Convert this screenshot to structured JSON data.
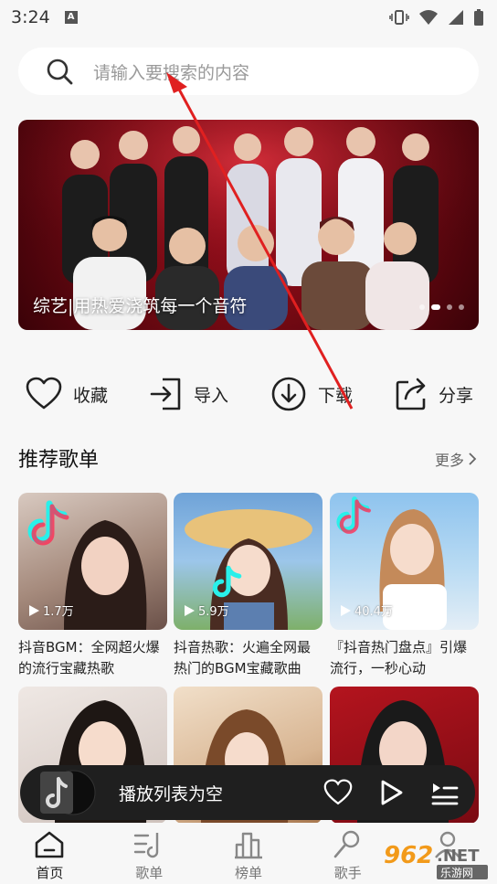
{
  "status": {
    "time": "3:24",
    "a_badge": "A"
  },
  "search": {
    "placeholder": "请输入要搜索的内容"
  },
  "banner": {
    "caption": "综艺|用热爱浇筑每一个音符",
    "dots": 4,
    "active_dot": 1
  },
  "actions": [
    {
      "label": "收藏",
      "icon": "heart-icon"
    },
    {
      "label": "导入",
      "icon": "import-icon"
    },
    {
      "label": "下载",
      "icon": "download-icon"
    },
    {
      "label": "分享",
      "icon": "share-icon"
    }
  ],
  "section": {
    "title": "推荐歌单",
    "more": "更多"
  },
  "playlists": [
    {
      "count": "1.7万",
      "title": "抖音BGM：全网超火爆的流行宝藏热歌"
    },
    {
      "count": "5.9万",
      "title": "抖音热歌：火遍全网最热门的BGM宝藏歌曲"
    },
    {
      "count": "40.4万",
      "title": "『抖音热门盘点』引爆流行，一秒心动"
    },
    {
      "count": "",
      "title": ""
    },
    {
      "count": "",
      "title": ""
    },
    {
      "count": "",
      "title": ""
    }
  ],
  "player": {
    "status": "播放列表为空"
  },
  "nav": [
    {
      "label": "首页",
      "icon": "home-icon",
      "active": true
    },
    {
      "label": "歌单",
      "icon": "playlist-icon",
      "active": false
    },
    {
      "label": "榜单",
      "icon": "chart-icon",
      "active": false
    },
    {
      "label": "歌手",
      "icon": "singer-icon",
      "active": false
    },
    {
      "label": "",
      "icon": "profile-icon",
      "active": false
    }
  ],
  "watermark": {
    "brand": "962",
    "suffix": ".NET",
    "site": "乐游网"
  },
  "colors": {
    "banner_red": "#a30f1c",
    "player_bg": "#1f1f1f",
    "arrow_red": "#e02020"
  }
}
